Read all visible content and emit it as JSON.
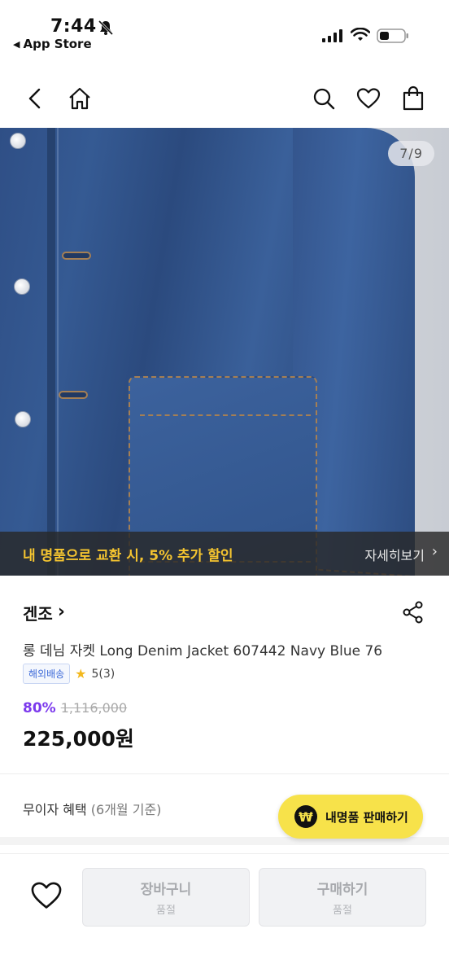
{
  "status": {
    "time": "7:44",
    "back_app": "App Store"
  },
  "nav": {
    "icons": [
      "back-icon",
      "home-icon",
      "search-icon",
      "heart-icon",
      "shopping-bag-icon"
    ]
  },
  "hero": {
    "counter": "7/9",
    "banner_text": "내 명품으로 교환 시, 5% 추가 할인",
    "banner_link": "자세히보기",
    "banner_chevron": "›"
  },
  "product": {
    "brand": "겐조",
    "brand_chevron": "›",
    "title": "롱 데님 자켓 Long Denim Jacket 607442 Navy Blue 76",
    "tag": "해외배송",
    "star": "★",
    "rating": "5(3)",
    "discount": "80%",
    "original_price": "1,116,000",
    "price": "225,000원"
  },
  "benefit": {
    "label": "무이자 혜택",
    "sub": "(6개월 기준)"
  },
  "sell_button": {
    "icon": "₩",
    "label": "내명품 판매하기"
  },
  "bottom": {
    "cart_label": "장바구니",
    "cart_sub": "품절",
    "buy_label": "구매하기",
    "buy_sub": "품절"
  },
  "colors": {
    "banner_text": "#f4c430",
    "discount": "#7c3aed",
    "sell_button_bg": "#f7e24a",
    "tag_text": "#3d6ad8"
  }
}
